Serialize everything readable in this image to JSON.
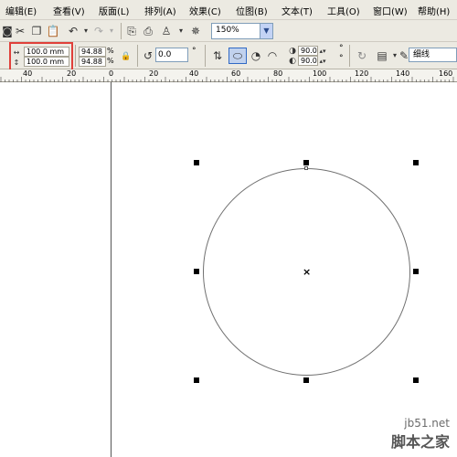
{
  "menu": {
    "items": [
      "编辑(E)",
      "查看(V)",
      "版面(L)",
      "排列(A)",
      "效果(C)",
      "位图(B)",
      "文本(T)",
      "工具(O)",
      "窗口(W)",
      "帮助(H)"
    ]
  },
  "toolbar": {
    "zoom": "150%"
  },
  "property_bar": {
    "width": "100.0 mm",
    "height": "100.0 mm",
    "scale_x": "94.88",
    "scale_y": "94.88",
    "percent_symbol": "%",
    "rotation": "0.0",
    "degree_symbol": "°",
    "start_angle": "90.0",
    "end_angle": "90.0",
    "outline": "细线"
  },
  "ruler": {
    "labels": [
      "40",
      "20",
      "0",
      "20",
      "40",
      "60",
      "80",
      "100",
      "120",
      "140",
      "160"
    ]
  },
  "watermark": {
    "site": "jb51.net",
    "name": "脚本之家"
  }
}
